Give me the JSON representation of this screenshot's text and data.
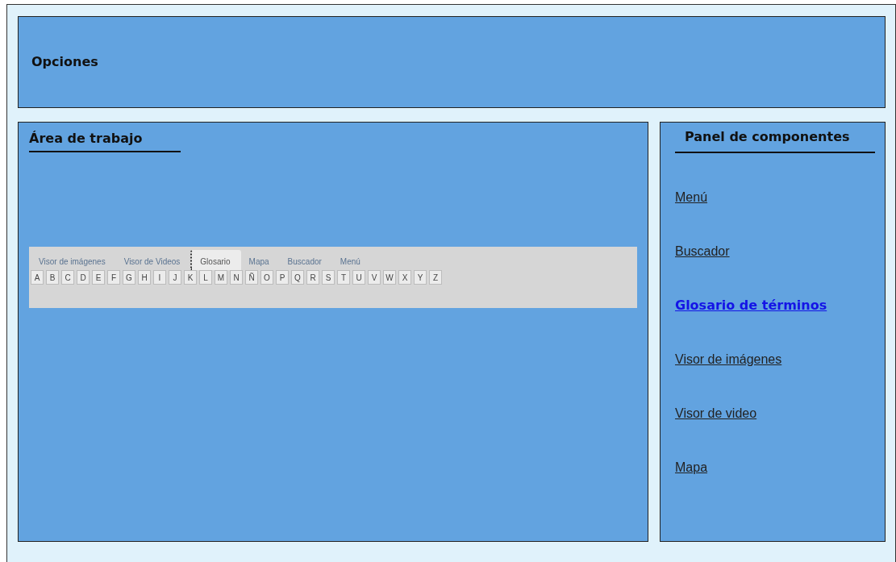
{
  "header": {
    "title": "Opciones"
  },
  "workspace": {
    "title": "Área de trabajo",
    "widget": {
      "tabs": [
        {
          "label": "Visor de imágenes",
          "selected": false
        },
        {
          "label": "Visor de Videos",
          "selected": false
        },
        {
          "label": "Glosario",
          "selected": true
        },
        {
          "label": "Mapa",
          "selected": false
        },
        {
          "label": "Buscador",
          "selected": false
        },
        {
          "label": "Menú",
          "selected": false
        }
      ],
      "letters": [
        "A",
        "B",
        "C",
        "D",
        "E",
        "F",
        "G",
        "H",
        "I",
        "J",
        "K",
        "L",
        "M",
        "N",
        "Ñ",
        "O",
        "P",
        "Q",
        "R",
        "S",
        "T",
        "U",
        "V",
        "W",
        "X",
        "Y",
        "Z"
      ]
    }
  },
  "panel": {
    "title": "Panel de componentes",
    "items": [
      {
        "label": "Menú",
        "selected": false
      },
      {
        "label": "Buscador",
        "selected": false
      },
      {
        "label": "Glosario de términos",
        "selected": true
      },
      {
        "label": "Visor de imágenes",
        "selected": false
      },
      {
        "label": "Visor de video",
        "selected": false
      },
      {
        "label": "Mapa",
        "selected": false
      }
    ]
  }
}
